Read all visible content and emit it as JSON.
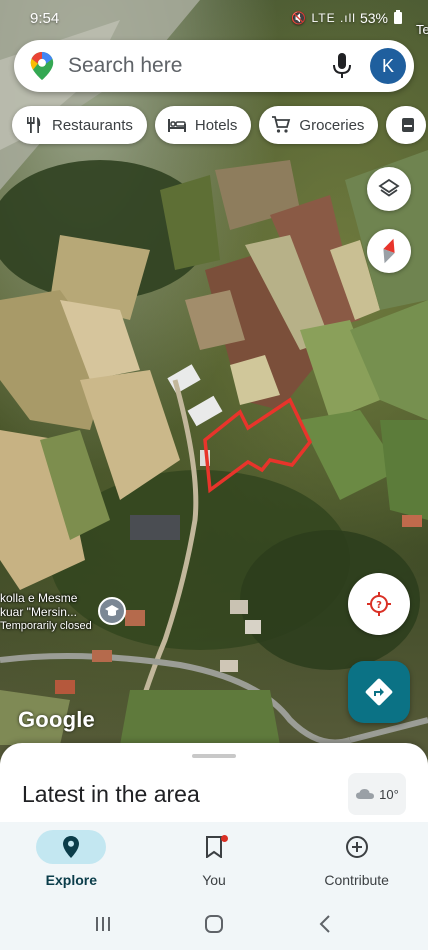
{
  "status_bar": {
    "time": "9:54",
    "icons": "🔇 LTE .ıll",
    "battery": "53%"
  },
  "search": {
    "placeholder": "Search here",
    "avatar_letter": "K"
  },
  "chips": [
    {
      "label": "Restaurants",
      "icon": "fork-knife-icon"
    },
    {
      "label": "Hotels",
      "icon": "bed-icon"
    },
    {
      "label": "Groceries",
      "icon": "cart-icon"
    }
  ],
  "map": {
    "place_label_line1": "kolla e Mesme",
    "place_label_line2": "kuar \"Mersin...",
    "place_label_status": "Temporarily closed",
    "edge_label": "Te",
    "attribution": "Google",
    "highlight_color": "#e8342b"
  },
  "sheet": {
    "title": "Latest in the area",
    "weather_temp": "10°"
  },
  "bottom_nav": [
    {
      "label": "Explore",
      "icon": "location-pin-icon",
      "active": true
    },
    {
      "label": "You",
      "icon": "bookmark-icon",
      "active": false
    },
    {
      "label": "Contribute",
      "icon": "add-circle-icon",
      "active": false
    }
  ],
  "colors": {
    "accent": "#0b7285",
    "active_nav_bg": "#c3e7f1",
    "avatar_bg": "#1f5f9e"
  }
}
